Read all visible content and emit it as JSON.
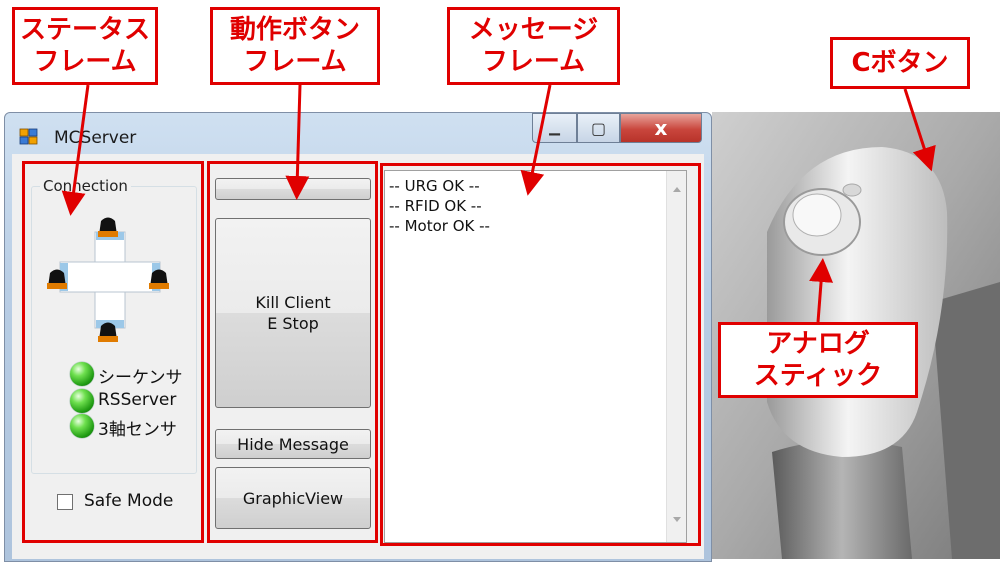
{
  "window": {
    "title": "MCServer",
    "minimize_glyph": "▁",
    "maximize_glyph": "▢",
    "close_glyph": "x"
  },
  "status_frame": {
    "group_title": "Connection",
    "indicators": [
      {
        "label": "シーケンサ",
        "status": "green"
      },
      {
        "label": "RSServer",
        "status": "green"
      },
      {
        "label": "3軸センサ",
        "status": "green"
      }
    ],
    "safe_mode_label": "Safe Mode",
    "safe_mode_checked": false
  },
  "action_frame": {
    "kill_button_label": "Kill Client\nE Stop",
    "hide_message_label": "Hide Message",
    "graphic_view_label": "GraphicView"
  },
  "message_frame": {
    "lines": [
      "-- URG OK --",
      "-- RFID OK --",
      "-- Motor OK --"
    ]
  },
  "annotations": {
    "status_frame": [
      "ステータス",
      "フレーム"
    ],
    "action_frame": [
      "動作ボタン",
      "フレーム"
    ],
    "message_frame": [
      "メッセージ",
      "フレーム"
    ],
    "c_button": "Cボタン",
    "analog_stick": [
      "アナログ",
      "スティック"
    ]
  },
  "colors": {
    "annotation_red": "#e00000",
    "led_green": "#2fb51d",
    "close_button": "#c9463d"
  }
}
